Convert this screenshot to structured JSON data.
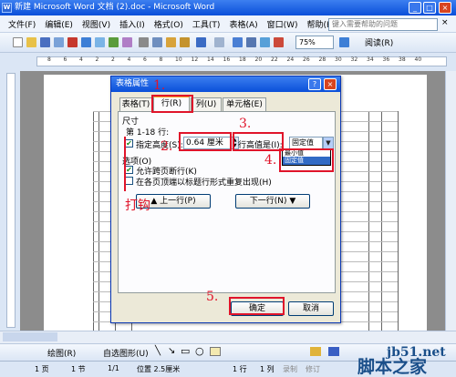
{
  "window": {
    "title": "新建 Microsoft Word 文档 (2).doc - Microsoft Word",
    "app_icon": "W"
  },
  "menu": [
    "文件(F)",
    "编辑(E)",
    "视图(V)",
    "插入(I)",
    "格式(O)",
    "工具(T)",
    "表格(A)",
    "窗口(W)",
    "帮助(H)"
  ],
  "help_box": {
    "placeholder": "键入需要帮助的问题"
  },
  "toolbar": {
    "zoom": "75%",
    "read_label": "阅读(R)"
  },
  "ruler_numbers": [
    "8",
    "6",
    "4",
    "2",
    "2",
    "4",
    "6",
    "8",
    "10",
    "12",
    "14",
    "16",
    "18",
    "20",
    "22",
    "24",
    "26",
    "28",
    "30",
    "32",
    "34",
    "36",
    "38",
    "40"
  ],
  "dialog": {
    "title": "表格属性",
    "tabs": [
      "表格(T)",
      "行(R)",
      "列(U)",
      "单元格(E)"
    ],
    "section_size": "尺寸",
    "row_range": "第 1-18 行:",
    "specify_height_label": "指定高度(S):",
    "height_value": "0.64 厘米",
    "row_height_is_label": "行高值是(I):",
    "row_height_mode": "固定值",
    "dropdown_options": [
      "最小值",
      "固定值"
    ],
    "options_label": "选项(O)",
    "allow_break": "允许跨页断行(K)",
    "repeat_header": "在各页顶端以标题行形式重复出现(H)",
    "prev_row": "上一行(P)",
    "next_row": "下一行(N)",
    "ok": "确定",
    "cancel": "取消"
  },
  "draw_bar": {
    "draw": "绘图(R)",
    "autoshapes": "自选图形(U)"
  },
  "status": {
    "page": "1 页",
    "section": "1 节",
    "page_of": "1/1",
    "position": "位置 2.5厘米",
    "line": "1 行",
    "col": "1 列",
    "rec": "录制",
    "trk": "修订"
  },
  "annotations": {
    "step1": "1.",
    "step2": "2.",
    "step3": "3.",
    "step4": "4.",
    "step5": "5.",
    "tick": "打钩"
  },
  "watermark": {
    "site": "jb51.net",
    "name": "脚本之家"
  }
}
